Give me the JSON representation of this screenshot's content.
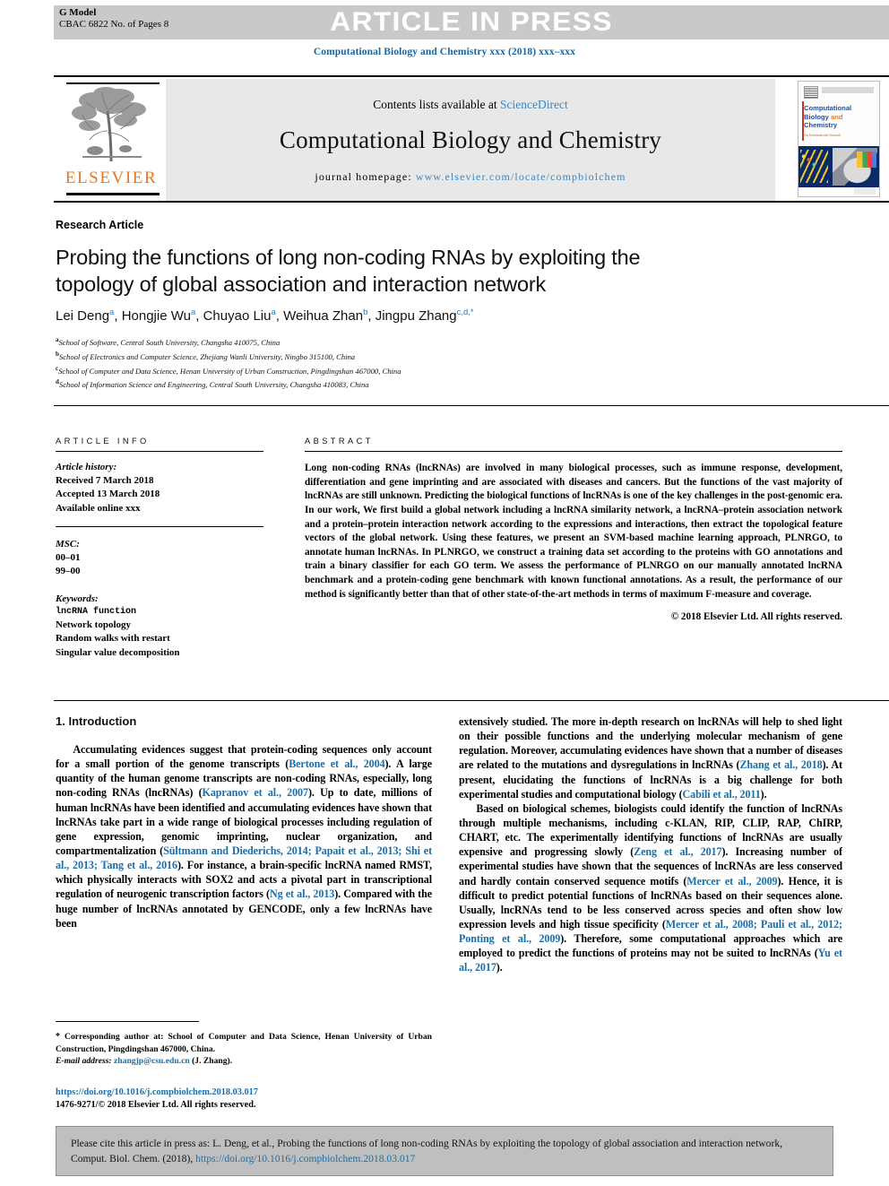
{
  "banner": {
    "article_in_press": "ARTICLE IN PRESS",
    "g_model_line1": "G Model",
    "g_model_line2": "CBAC 6822 No. of Pages 8"
  },
  "running_head": "Computational Biology and Chemistry xxx (2018) xxx–xxx",
  "masthead": {
    "contents_prefix": "Contents lists available at ",
    "sciencedirect": "ScienceDirect",
    "journal_name": "Computational Biology and Chemistry",
    "homepage_prefix": "journal homepage: ",
    "homepage_url": "www.elsevier.com/locate/compbiolchem",
    "publisher": "ELSEVIER"
  },
  "cover": {
    "title_line1": "Computational",
    "title_line2": "Biology",
    "title_and": "and",
    "title_line3": "Chemistry",
    "subtitle": "An International Journal"
  },
  "article": {
    "type": "Research Article",
    "title_line1": "Probing the functions of long non-coding RNAs by exploiting",
    "title_line2": "the topology of global association and interaction network",
    "authors": [
      {
        "name": "Lei Deng",
        "sup": "a",
        "sep": ", "
      },
      {
        "name": "Hongjie Wu",
        "sup": "a",
        "sep": ", "
      },
      {
        "name": "Chuyao Liu",
        "sup": "a",
        "sep": ", "
      },
      {
        "name": "Weihua Zhan",
        "sup": "b",
        "sep": ", "
      },
      {
        "name": "Jingpu Zhang",
        "sup": "c,d,*",
        "sep": ""
      }
    ],
    "affiliations": [
      {
        "mark": "a",
        "text": "School of Software, Central South University, Changsha 410075, China"
      },
      {
        "mark": "b",
        "text": "School of Electronics and Computer Science, Zhejiang Wanli University, Ningbo 315100, China"
      },
      {
        "mark": "c",
        "text": "School of Computer and Data Science, Henan University of Urban Construction, Pingdingshan 467000, China"
      },
      {
        "mark": "d",
        "text": "School of Information Science and Engineering, Central South University, Changsha 410083, China"
      }
    ]
  },
  "article_info": {
    "label": "ARTICLE INFO",
    "history_header": "Article history:",
    "history": [
      "Received 7 March 2018",
      "Accepted 13 March 2018",
      "Available online xxx"
    ],
    "msc_header": "MSC:",
    "msc": [
      "00–01",
      "99–00"
    ],
    "keywords_header": "Keywords:",
    "keywords": [
      "lncRNA function",
      "Network topology",
      "Random walks with restart",
      "Singular value decomposition"
    ]
  },
  "abstract": {
    "label": "ABSTRACT",
    "text": "Long non-coding RNAs (lncRNAs) are involved in many biological processes, such as immune response, development, differentiation and gene imprinting and are associated with diseases and cancers. But the functions of the vast majority of lncRNAs are still unknown. Predicting the biological functions of lncRNAs is one of the key challenges in the post-genomic era. In our work, We first build a global network including a lncRNA similarity network, a lncRNA–protein association network and a protein–protein interaction network according to the expressions and interactions, then extract the topological feature vectors of the global network. Using these features, we present an SVM-based machine learning approach, PLNRGO, to annotate human lncRNAs. In PLNRGO, we construct a training data set according to the proteins with GO annotations and train a binary classifier for each GO term. We assess the performance of PLNRGO on our manually annotated lncRNA benchmark and a protein-coding gene benchmark with known functional annotations. As a result, the performance of our method is significantly better than that of other state-of-the-art methods in terms of maximum F-measure and coverage.",
    "copyright": "© 2018 Elsevier Ltd. All rights reserved."
  },
  "introduction": {
    "heading": "1. Introduction",
    "left_paragraphs": [
      "Accumulating evidences suggest that protein-coding sequences only account for a small portion of the genome transcripts (Bertone et al., 2004). A large quantity of the human genome transcripts are non-coding RNAs, especially, long non-coding RNAs (lncRNAs) (Kapranov et al., 2007). Up to date, millions of human lncRNAs have been identified and accumulating evidences have shown that lncRNAs take part in a wide range of biological processes including regulation of gene expression, genomic imprinting, nuclear organization, and compartmentalization (Sültmann and Diederichs, 2014; Papait et al., 2013; Shi et al., 2013; Tang et al., 2016). For instance, a brain-specific lncRNA named RMST, which physically interacts with SOX2 and acts a pivotal part in transcriptional regulation of neurogenic transcription factors (Ng et al., 2013). Compared with the huge number of lncRNAs annotated by GENCODE, only a few lncRNAs have been"
    ],
    "right_paragraphs": [
      "extensively studied. The more in-depth research on lncRNAs will help to shed light on their possible functions and the underlying molecular mechanism of gene regulation. Moreover, accumulating evidences have shown that a number of diseases are related to the mutations and dysregulations in lncRNAs (Zhang et al., 2018). At present, elucidating the functions of lncRNAs is a big challenge for both experimental studies and computational biology (Cabili et al., 2011).",
      "Based on biological schemes, biologists could identify the function of lncRNAs through multiple mechanisms, including c-KLAN, RIP, CLIP, RAP, ChIRP, CHART, etc. The experimentally identifying functions of lncRNAs are usually expensive and progressing slowly (Zeng et al., 2017). Increasing number of experimental studies have shown that the sequences of lncRNAs are less conserved and hardly contain conserved sequence motifs (Mercer et al., 2009). Hence, it is difficult to predict potential functions of lncRNAs based on their sequences alone. Usually, lncRNAs tend to be less conserved across species and often show low expression levels and high tissue specificity (Mercer et al., 2008; Pauli et al., 2012; Ponting et al., 2009). Therefore, some computational approaches which are employed to predict the functions of proteins may not be suited to lncRNAs (Yu et al., 2017)."
    ]
  },
  "footnote": {
    "star": "*",
    "corresponding": "Corresponding author at: School of Computer and Data Science, Henan University of Urban Construction, Pingdingshan 467000, China.",
    "email_label": "E-mail address:",
    "email": "zhangjp@csu.edu.cn",
    "email_owner": "(J. Zhang)."
  },
  "doi_block": {
    "doi": "https://doi.org/10.1016/j.compbiolchem.2018.03.017",
    "issn_line": "1476-9271/© 2018 Elsevier Ltd. All rights reserved."
  },
  "citation_box": {
    "text_before": "Please cite this article in press as: L. Deng, et al., Probing the functions of long non-coding RNAs by exploiting the topology of global association and interaction network, Comput. Biol. Chem. (2018), ",
    "doi": "https://doi.org/10.1016/j.compbiolchem.2018.03.017"
  },
  "colors": {
    "link": "#1a6fa8",
    "banner_grey": "#c9c9c9",
    "elsevier_orange": "#e87722"
  }
}
